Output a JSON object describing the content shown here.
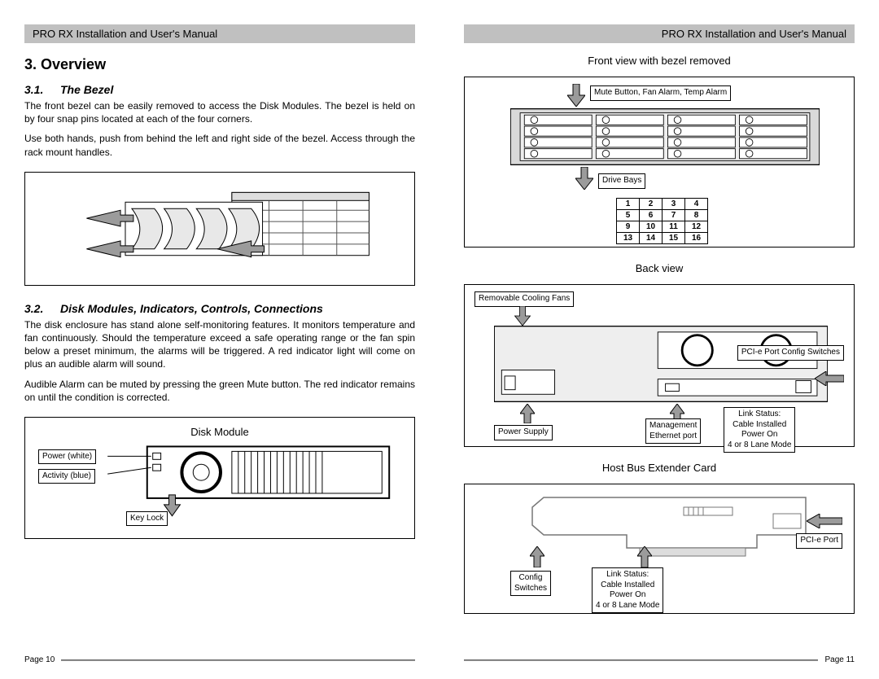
{
  "header": "PRO RX Installation and User's Manual",
  "left": {
    "page_no": "Page 10",
    "h1": "3.  Overview",
    "s1": {
      "num": "3.1.",
      "title": "The Bezel"
    },
    "p1": "The front bezel can be easily removed to access the Disk Modules.  The bezel is held on by four snap pins located at each of the four corners.",
    "p2": "Use both hands, push from behind the left and right side of the bezel.  Access through the rack mount handles.",
    "s2": {
      "num": "3.2.",
      "title": "Disk Modules, Indicators, Controls, Connections"
    },
    "p3": "The disk enclosure has stand alone self-monitoring features.  It monitors temperature and fan continuously.  Should the temperature exceed a safe operating range or the fan spin below a preset minimum, the alarms will be triggered.  A red indicator light will come on plus an audible alarm will sound.",
    "p4": "Audible Alarm can be muted by pressing the green Mute button.  The red indicator remains on until the condition is corrected.",
    "dm_title": "Disk Module",
    "dm_labels": {
      "power": "Power (white)",
      "activity": "Activity (blue)",
      "keylock": "Key Lock"
    }
  },
  "right": {
    "page_no": "Page 11",
    "front_title": "Front view with bezel removed",
    "mute_label": "Mute Button, Fan Alarm, Temp Alarm",
    "drive_bays": "Drive Bays",
    "bays": [
      [
        1,
        2,
        3,
        4
      ],
      [
        5,
        6,
        7,
        8
      ],
      [
        9,
        10,
        11,
        12
      ],
      [
        13,
        14,
        15,
        16
      ]
    ],
    "back_title": "Back view",
    "fans_label": "Removable Cooling Fans",
    "psu": "Power Supply",
    "mgmt": "Management\nEthernet port",
    "pcie": "PCI-e Port\nConfig Switches",
    "link_status": "Link Status:\nCable Installed\nPower On\n4 or 8 Lane Mode",
    "hbec_title": "Host Bus Extender Card",
    "hb_config": "Config\nSwitches",
    "hb_pcie": "PCI-e Port"
  }
}
